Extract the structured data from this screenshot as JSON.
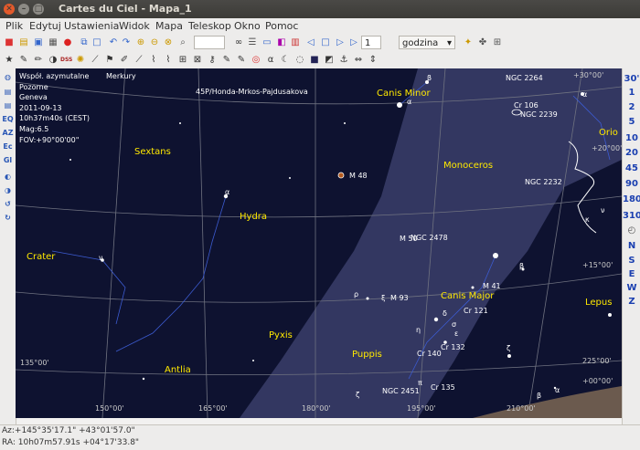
{
  "window": {
    "title": "Cartes du Ciel - Mapa_1"
  },
  "menu": [
    "Plik",
    "Edytuj",
    "Ustawienia",
    "Widok",
    "Mapa",
    "Teleskop",
    "Okno",
    "Pomoc"
  ],
  "toolbar": {
    "step_value": "1",
    "time_unit": "godzina"
  },
  "left_sidebar": [
    "EQ",
    "AZ",
    "Ec",
    "Gl"
  ],
  "right_sidebar": {
    "fov": [
      "30'",
      "1",
      "2",
      "5",
      "10",
      "20",
      "45",
      "90",
      "180",
      "310"
    ],
    "directions": [
      "N",
      "S",
      "E",
      "W",
      "Z"
    ]
  },
  "info": {
    "lines": [
      "Współ. azymutalne",
      "Pozorne",
      "Geneva",
      "2011-09-13",
      "10h37m40s (CEST)",
      "Mag:6.5",
      "FOV:+90°00'00\""
    ]
  },
  "constellations": [
    "Canis Minor",
    "Sextans",
    "Monoceros",
    "Hydra",
    "Crater",
    "Canis Major",
    "Pyxis",
    "Puppis",
    "Antlia",
    "Lepus",
    "Orio"
  ],
  "objects": [
    "Merkury",
    "45P/Honda-Mrkos-Pajdusakova",
    "NGC 2264",
    "Cr 106",
    "NGC 2239",
    "M 48",
    "NGC 2232",
    "M 50",
    "NGC 2478",
    "M 93",
    "M 41",
    "Cr 121",
    "Cr 132",
    "Cr 140",
    "Cr 135",
    "NGC 2451"
  ],
  "greek": [
    "β",
    "α",
    "α",
    "ν",
    "α",
    "β",
    "ρ",
    "ξ",
    "η",
    "δ",
    "σ",
    "ε",
    "ζ",
    "π",
    "ζ",
    "α",
    "β",
    "κ",
    "ν"
  ],
  "grid_labels": [
    "+15°00'",
    "135°00'",
    "150°00'",
    "165°00'",
    "180°00'",
    "195°00'",
    "210°00'",
    "225°00'",
    "+00°00'",
    "+30°00'",
    "+20°00'"
  ],
  "status": {
    "azalt": "Az:+145°35'17.1\" +43°01'57.0\"",
    "radec": "RA: 10h07m57.91s +04°17'33.8\""
  }
}
